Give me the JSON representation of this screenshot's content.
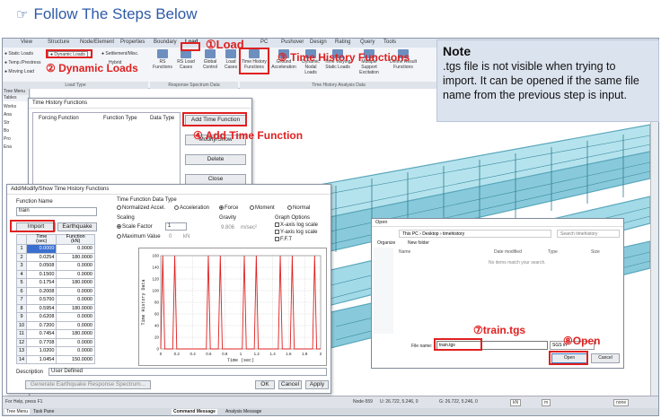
{
  "header": {
    "title": "Follow The Steps Below"
  },
  "menubar": {
    "items": [
      "View",
      "Structure",
      "Node/Element",
      "Properties",
      "Boundary",
      "Load",
      "PC",
      "Pushover",
      "Design",
      "Rating",
      "Query",
      "Tools"
    ]
  },
  "ribbon": {
    "left_items": [
      "Static Loads",
      "Temp./Prestress",
      "Moving Load"
    ],
    "dynamic_loads": "Dynamic Loads",
    "settlement": "Settlement/Misc.",
    "hybrid": "Hybrid",
    "load_type_label": "Load Type",
    "rs_functions": "RS Functions",
    "rs_load_cases": "RS Load Cases",
    "global_control": "Global Control",
    "load_cases": "Load Cases",
    "rs_group_label": "Response Spectrum Data",
    "th_functions": "Time History Functions",
    "ground_accel": "Ground Acceleration",
    "dynamic_nodal": "Dynamic Nodal Loads",
    "time_varying": "Time Varying Static Loads",
    "multiple_support": "Multiple Support Excitation",
    "define_result": "Define Result Functions",
    "th_group_label": "Time History Analysis Data"
  },
  "callouts": {
    "c1": "①Load",
    "c2": "② Dynamic Loads",
    "c3": "③ Time History Functions",
    "c4": "④ Add Time Function",
    "c7": "⑦train.tgs",
    "c8": "⑧Open"
  },
  "note": {
    "title": "Note",
    "body": ".tgs file is not visible when trying to import. It can be opened if the same file name from the previous step is input."
  },
  "left_panel": {
    "tab1": "Tree Menu",
    "tab2": "Tables",
    "items": [
      "Works",
      "Ana",
      "Str",
      "Bo",
      "Pro",
      "Ena"
    ]
  },
  "thf_dialog": {
    "title": "Time History Functions",
    "col_forcing": "Forcing Function",
    "col_type": "Function Type",
    "col_data": "Data Type",
    "add_btn": "Add Time Function",
    "modify_btn": "Modify/Show",
    "delete_btn": "Delete",
    "close_btn": "Close"
  },
  "amsd": {
    "title": "Add/Modify/Show Time History Functions",
    "fn_name_label": "Function Name",
    "fn_name_value": "train",
    "import_btn": "Import",
    "earthquake_btn": "Earthquake",
    "col_time": "Time\n(sec)",
    "col_function": "Function\n(kN)",
    "rows": [
      [
        "1",
        "0.0000",
        "0.0000"
      ],
      [
        "2",
        "0.0254",
        "180.0000"
      ],
      [
        "3",
        "0.0508",
        "0.0000"
      ],
      [
        "4",
        "0.1500",
        "0.0000"
      ],
      [
        "5",
        "0.1754",
        "180.0000"
      ],
      [
        "6",
        "0.2008",
        "0.0000"
      ],
      [
        "7",
        "0.5700",
        "0.0000"
      ],
      [
        "8",
        "0.5954",
        "180.0000"
      ],
      [
        "9",
        "0.6208",
        "0.0000"
      ],
      [
        "10",
        "0.7200",
        "0.0000"
      ],
      [
        "11",
        "0.7454",
        "180.0000"
      ],
      [
        "12",
        "0.7708",
        "0.0000"
      ],
      [
        "13",
        "1.0200",
        "0.0000"
      ],
      [
        "14",
        "1.0454",
        "150.0000"
      ]
    ],
    "tfdt_label": "Time Function Data Type",
    "radio_norm": "Normalized Accel.",
    "radio_accel": "Acceleration",
    "radio_force": "Force",
    "radio_moment": "Moment",
    "radio_normal": "Normal",
    "scaling_label": "Scaling",
    "scale_factor_label": "Scale Factor",
    "scale_factor_value": "1",
    "max_value_label": "Maximum Value",
    "max_value_value": "0",
    "max_value_unit": "kN",
    "gravity_label": "Gravity",
    "gravity_value": "9.806",
    "gravity_unit": "m/sec²",
    "graph_options_label": "Graph Options",
    "opt_xlog": "X-axis log scale",
    "opt_ylog": "Y-axis log scale",
    "opt_fft": "F.F.T",
    "graph_ylabel": "Time History Data",
    "graph_xlabel": "Time (sec)",
    "description_label": "Description",
    "description_value": "User Defined",
    "gen_eq_btn": "Generate Earthquake Response Spectrum...",
    "ok_btn": "OK",
    "cancel_btn": "Cancel",
    "apply_btn": "Apply"
  },
  "chart_data": {
    "type": "line",
    "xlabel": "Time (sec)",
    "ylabel": "Time History Data",
    "xlim": [
      0,
      2.0
    ],
    "ylim": [
      0,
      160
    ],
    "xticks": [
      "0",
      "0.2",
      "0.4",
      "0.6",
      "0.8",
      "1",
      "1.2",
      "1.4",
      "1.6",
      "1.8",
      "2"
    ],
    "yticks": [
      "0",
      "20",
      "40",
      "60",
      "80",
      "100",
      "120",
      "140",
      "160"
    ],
    "series": [
      {
        "x": [
          0,
          0.025,
          0.05,
          0.15,
          0.175,
          0.2,
          0.57,
          0.595,
          0.62,
          0.72,
          0.745,
          0.77,
          1.02,
          1.045,
          1.07,
          1.17,
          1.195,
          1.22,
          1.47,
          1.495,
          1.52,
          1.62,
          1.645,
          1.67,
          1.9,
          1.925,
          1.95,
          2.0
        ],
        "y": [
          0,
          160,
          0,
          0,
          160,
          0,
          0,
          160,
          0,
          0,
          160,
          0,
          0,
          160,
          0,
          0,
          160,
          0,
          0,
          160,
          0,
          0,
          160,
          0,
          0,
          160,
          0,
          0
        ]
      }
    ],
    "grid": true,
    "line_color": "#e02020"
  },
  "open_dialog": {
    "title": "Open",
    "path_parts": [
      "This PC",
      "Desktop",
      "timehistory"
    ],
    "search_placeholder": "Search timehistory",
    "organize": "Organize",
    "new_folder": "New folder",
    "col_name": "Name",
    "col_date": "Date modified",
    "col_type": "Type",
    "col_size": "Size",
    "empty_msg": "No items match your search.",
    "file_name_label": "File name:",
    "file_name_value": "train.tgs",
    "filter": "SGS in",
    "open_btn": "Open",
    "cancel_btn": "Cancel"
  },
  "status": {
    "help": "For Help, press F1",
    "node": "Node-559",
    "u": "U: 26.722, 5.246, 0",
    "g": "G: 26.722, 5.246, 0",
    "unit": "kN",
    "unit2": "m",
    "none": "none",
    "tab_tree": "Tree Menu",
    "tab_task": "Task Pane",
    "tab_cmd": "Command Message",
    "tab_analysis": "Analysis Message"
  }
}
